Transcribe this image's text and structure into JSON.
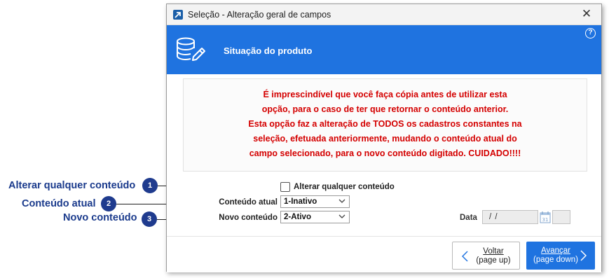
{
  "window": {
    "title": "Seleção - Alteração geral de campos",
    "close_glyph": "✕",
    "app_icon": "arrow-app-icon"
  },
  "banner": {
    "title": "Situação do produto",
    "icon": "database-edit-icon",
    "help_glyph": "?",
    "bg_color": "#1f73e0"
  },
  "warning": {
    "color": "#d40000",
    "lines": [
      "É imprescindível que você faça cópia antes de utilizar esta",
      "opção, para o caso de ter que retornar o conteúdo anterior.",
      "Esta opção faz a alteração de TODOS os cadastros constantes na",
      "seleção, efetuada anteriormente, mudando o conteúdo atual do",
      "campo selecionado, para o novo conteúdo digitado. CUIDADO!!!!"
    ]
  },
  "form": {
    "alter_any_label": "Alterar qualquer conteúdo",
    "alter_any_checked": false,
    "current_label": "Conteúdo atual",
    "current_value": "1-Inativo",
    "new_label": "Novo conteúdo",
    "new_value": "2-Ativo",
    "date_label": "Data",
    "date_value": "/ /"
  },
  "footer": {
    "back_line1": "Voltar",
    "back_line2": "(page up)",
    "next_line1": "Avançar",
    "next_line2": "(page down)"
  },
  "callouts": [
    {
      "label": "Alterar qualquer conteúdo",
      "number": "1"
    },
    {
      "label": "Conteúdo atual",
      "number": "2"
    },
    {
      "label": "Novo conteúdo",
      "number": "3"
    }
  ]
}
